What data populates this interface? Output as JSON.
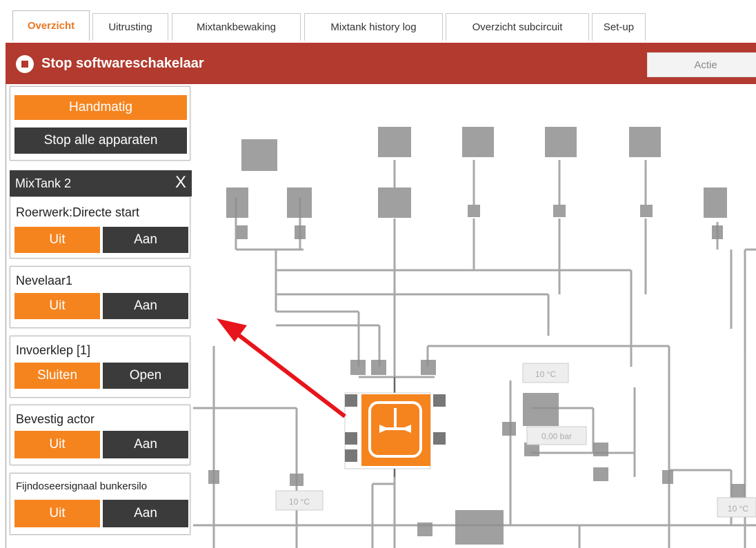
{
  "tabs": [
    {
      "label": "Overzicht"
    },
    {
      "label": "Uitrusting"
    },
    {
      "label": "Mixtankbewaking"
    },
    {
      "label": "Mixtank history log"
    },
    {
      "label": "Overzicht subcircuit"
    },
    {
      "label": "Set-up"
    }
  ],
  "header": {
    "stop_label": "Stop softwareschakelaar",
    "action_label": "Actie"
  },
  "mode_panel": {
    "manual_label": "Handmatig",
    "stop_all_label": "Stop alle apparaten"
  },
  "mixtank": {
    "title": "MixTank 2",
    "close_label": "X"
  },
  "devices": [
    {
      "name": "Roerwerk:Directe start",
      "off_label": "Uit",
      "on_label": "Aan"
    },
    {
      "name": "Nevelaar1",
      "off_label": "Uit",
      "on_label": "Aan"
    },
    {
      "name": "Invoerklep [1]",
      "off_label": "Sluiten",
      "on_label": "Open"
    },
    {
      "name": "Bevestig actor",
      "off_label": "Uit",
      "on_label": "Aan"
    },
    {
      "name": "Fijndoseersignaal bunkersilo",
      "off_label": "Uit",
      "on_label": "Aan"
    }
  ],
  "diagram": {
    "temp_label_1": "10 °C",
    "temp_label_2": "10 °C",
    "temp_label_3": "10 °C",
    "pressure_label": "0,00 bar"
  },
  "colors": {
    "accent": "#f5841f",
    "header_red": "#b23a2e",
    "dark": "#3b3b3b",
    "pipe": "#8c8c8c",
    "arrow": "#e8141b"
  }
}
